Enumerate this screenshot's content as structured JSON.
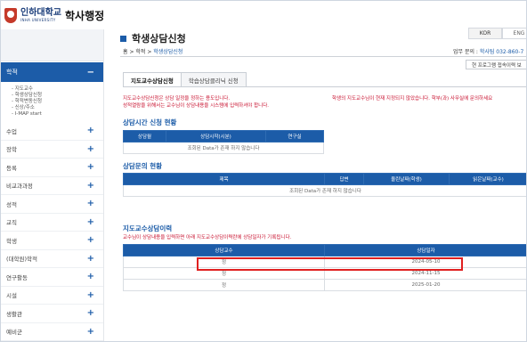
{
  "brand": {
    "university": "인하대학교",
    "english": "INHA UNIVERSITY",
    "app_name": "학사행정"
  },
  "languages": [
    "KOR",
    "ENG"
  ],
  "sidebar": {
    "active": {
      "label": "학적",
      "toggle": "−"
    },
    "sub_items": [
      "지도교수",
      "학생상담신청",
      "학적변동신청",
      "신상/주소",
      "I-MAP start"
    ],
    "items": [
      {
        "label": "수업"
      },
      {
        "label": "장학"
      },
      {
        "label": "등록"
      },
      {
        "label": "비교과과정"
      },
      {
        "label": "성적"
      },
      {
        "label": "교직"
      },
      {
        "label": "학생"
      },
      {
        "label": "(대학원)학적"
      },
      {
        "label": "연구활동"
      },
      {
        "label": "시설"
      },
      {
        "label": "생활관"
      },
      {
        "label": "예비군"
      }
    ],
    "expand_symbol": "+"
  },
  "header": {
    "title": "학생상담신청",
    "breadcrumb": {
      "home": "홈",
      "sep1": " > ",
      "section": "학적",
      "sep2": " > ",
      "current": "학생상담신청"
    },
    "contact_label": "업무 문의 : ",
    "contact_value": "학사팀 032-860-7",
    "program_button": "현 프로그램 접속이력 보"
  },
  "tabs": [
    {
      "label": "지도교수상담신청",
      "active": true
    },
    {
      "label": "학습상담클리닉 신청",
      "active": false
    }
  ],
  "notices": {
    "left_line1": "지도교수상담신청은 상담 일정을 정하는 용도입니다.",
    "left_line2": "성적열람을 위해서는 교수님이 상담내용을 시스템에 입력하셔야 합니다.",
    "right": "학생의 지도교수님이 현재 지정되지 않았습니다. 학부(과) 사무실에 문의하세요"
  },
  "schedule_section": {
    "title": "상담시간 신청 현황",
    "columns": [
      "상담월",
      "상담시작(시분)",
      "연구실"
    ],
    "empty": "조회된 Data가 존재 하지 않습니다"
  },
  "question_section": {
    "title": "상담문의 현황",
    "columns": [
      "제목",
      "답변",
      "올린날짜(학생)",
      "읽은날짜(교수)"
    ],
    "empty": "조회된 Data가 존재 하지 않습니다"
  },
  "history_section": {
    "title": "지도교수상담이력",
    "note": "교수님이 상담내용을 입력하면 아래 지도교수상담이력란에 상담일자가 기록됩니다.",
    "columns": [
      "상담교수",
      "상담일자"
    ],
    "rows": [
      {
        "professor": "정",
        "date": "2024-05-10"
      },
      {
        "professor": "정",
        "date": "2024-11-15"
      },
      {
        "professor": "정",
        "date": "2025-01-20"
      }
    ]
  },
  "colors": {
    "primary": "#1c5ca8",
    "alert": "#c8102e",
    "highlight_box": "#e02020"
  }
}
